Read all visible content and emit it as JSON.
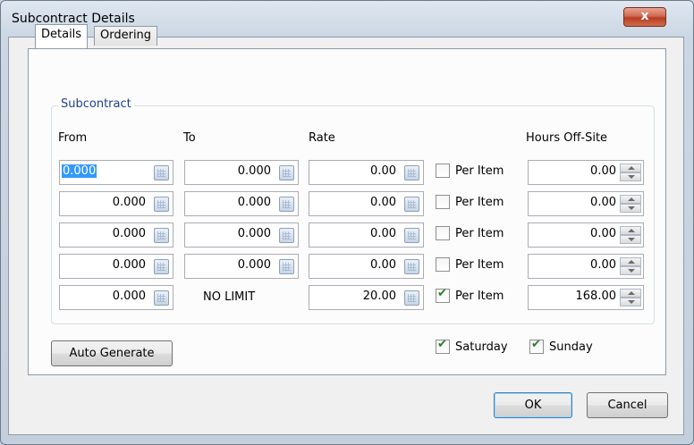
{
  "window": {
    "title": "Subcontract Details",
    "close_glyph": "x"
  },
  "tabs": [
    {
      "label": "Details",
      "active": true
    },
    {
      "label": "Ordering",
      "active": false
    }
  ],
  "group": {
    "label": "Subcontract"
  },
  "columns": {
    "from": "From",
    "to": "To",
    "rate": "Rate",
    "hours": "Hours Off-Site"
  },
  "rows": [
    {
      "from": "0.000",
      "to": "0.000",
      "rate": "0.00",
      "per_item_label": "Per Item",
      "per_item": false,
      "hours": "0.00"
    },
    {
      "from": "0.000",
      "to": "0.000",
      "rate": "0.00",
      "per_item_label": "Per Item",
      "per_item": false,
      "hours": "0.00"
    },
    {
      "from": "0.000",
      "to": "0.000",
      "rate": "0.00",
      "per_item_label": "Per Item",
      "per_item": false,
      "hours": "0.00"
    },
    {
      "from": "0.000",
      "to": "0.000",
      "rate": "0.00",
      "per_item_label": "Per Item",
      "per_item": false,
      "hours": "0.00"
    },
    {
      "from": "0.000",
      "to": "NO LIMIT",
      "rate": "20.00",
      "per_item_label": "Per Item",
      "per_item": true,
      "hours": "168.00"
    }
  ],
  "days": {
    "saturday_label": "Saturday",
    "saturday": true,
    "sunday_label": "Sunday",
    "sunday": true
  },
  "buttons": {
    "auto_generate": "Auto Generate",
    "ok": "OK",
    "cancel": "Cancel"
  },
  "icons": {
    "calculator": "calculator-icon",
    "spinner": "spinner-icon",
    "close": "close-icon"
  },
  "colors": {
    "selection": "#3399ff",
    "close": "#c7432a",
    "group_label": "#1f3f8f"
  }
}
